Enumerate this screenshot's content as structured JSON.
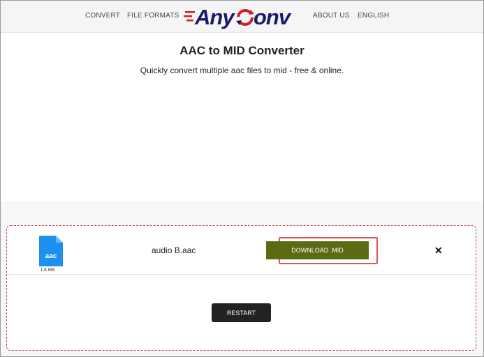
{
  "header": {
    "nav_left": [
      {
        "label": "CONVERT"
      },
      {
        "label": "FILE FORMATS"
      }
    ],
    "logo": {
      "text": "AnyConv",
      "icon": "anyconv-logo-icon"
    },
    "nav_right": [
      {
        "label": "ABOUT US"
      },
      {
        "label": "ENGLISH"
      }
    ]
  },
  "main": {
    "title": "AAC to MID Converter",
    "subtitle": "Quickly convert multiple aac files to mid - free & online."
  },
  "file": {
    "icon": "file-aac-icon",
    "icon_label": "aac",
    "size": "1.8 MB",
    "name": "audio B.aac",
    "download_label": "DOWNLOAD .MID",
    "remove_icon": "close-icon"
  },
  "actions": {
    "restart_label": "RESTART"
  },
  "colors": {
    "download_button": "#5b6b12",
    "highlight_border": "#dd5555",
    "panel_border": "#c0454e",
    "file_icon": "#1e90f0",
    "logo_dark": "#1a1a6a",
    "logo_red": "#cc2222"
  }
}
